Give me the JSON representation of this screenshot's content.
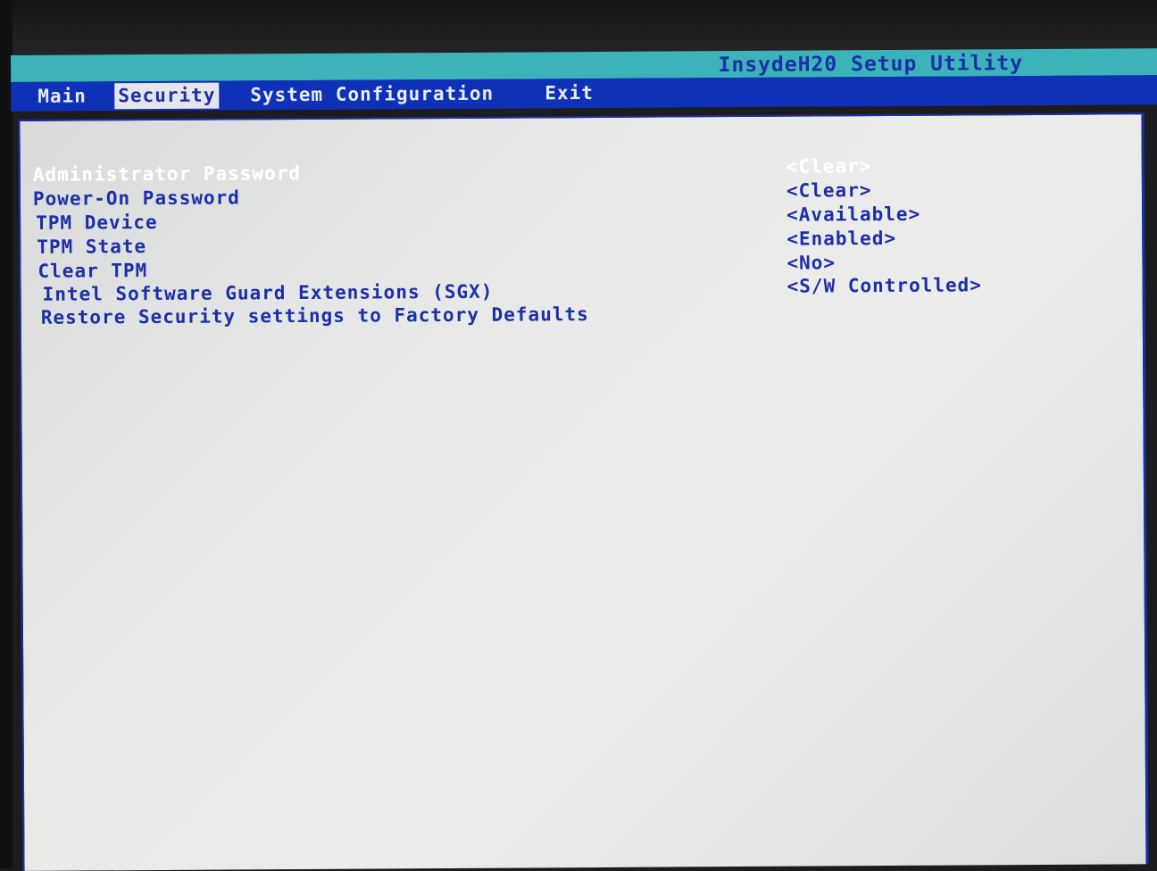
{
  "app_title": "InsydeH20 Setup Utility",
  "tabs": [
    {
      "label": "Main",
      "active": false
    },
    {
      "label": "Security",
      "active": true
    },
    {
      "label": "System Configuration",
      "active": false
    },
    {
      "label": "Exit",
      "active": false
    }
  ],
  "settings": [
    {
      "label": "Administrator Password",
      "value": "<Clear>",
      "selected": true
    },
    {
      "label": "Power-On Password",
      "value": "<Clear>"
    },
    {
      "label": "TPM Device",
      "value": "<Available>"
    },
    {
      "label": "TPM State",
      "value": "<Enabled>"
    },
    {
      "label": "Clear TPM",
      "value": "<No>"
    },
    {
      "label": "Intel Software Guard Extensions (SGX)",
      "value": "<S/W Controlled>"
    },
    {
      "label": "Restore Security settings to Factory Defaults",
      "value": ""
    }
  ],
  "colors": {
    "title_bar": "#3bb3b8",
    "menu_bar": "#0f31b8",
    "text": "#1b2fa8",
    "selected_text": "#ffffff",
    "background": "#e9eae8"
  }
}
